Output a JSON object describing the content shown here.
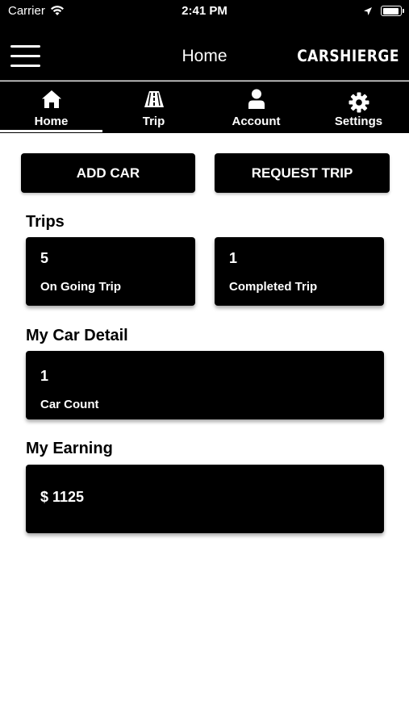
{
  "status_bar": {
    "carrier": "Carrier",
    "time": "2:41 PM",
    "battery_level": 0.95
  },
  "nav": {
    "title": "Home",
    "brand": "CARSHIERGE"
  },
  "tabs": [
    {
      "label": "Home",
      "icon": "home-icon",
      "selected": true
    },
    {
      "label": "Trip",
      "icon": "road-icon",
      "selected": false
    },
    {
      "label": "Account",
      "icon": "user-icon",
      "selected": false
    },
    {
      "label": "Settings",
      "icon": "gear-icon",
      "selected": false
    }
  ],
  "actions": {
    "add_car": "ADD CAR",
    "request_trip": "REQUEST TRIP"
  },
  "trips": {
    "title": "Trips",
    "ongoing": {
      "value": "5",
      "label": "On Going Trip"
    },
    "completed": {
      "value": "1",
      "label": "Completed Trip"
    }
  },
  "car_detail": {
    "title": "My Car Detail",
    "value": "1",
    "label": "Car Count"
  },
  "earning": {
    "title": "My Earning",
    "value": "$ 1125"
  },
  "colors": {
    "primary": "#000000",
    "background": "#ffffff",
    "text_on_primary": "#ffffff"
  }
}
